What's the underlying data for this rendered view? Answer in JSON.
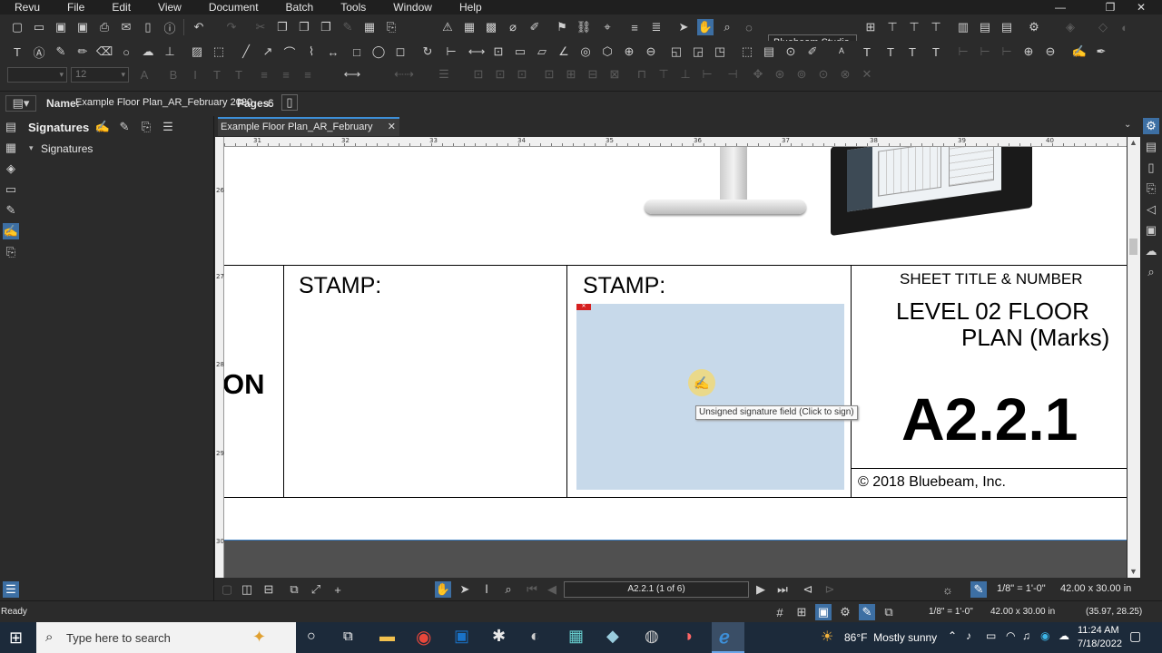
{
  "menu": [
    "Revu",
    "File",
    "Edit",
    "View",
    "Document",
    "Batch",
    "Tools",
    "Window",
    "Help"
  ],
  "toolbar": {
    "profile_label": "Bluebeam Studio",
    "font_name": "",
    "font_size": "12"
  },
  "docinfo": {
    "name_label": "Name:",
    "name_value": "Example Floor Plan_AR_February 2020",
    "pages_label": "Pages:",
    "pages_value": "6"
  },
  "signatures_panel": {
    "title": "Signatures",
    "tree_item": "Signatures"
  },
  "tab": {
    "title": "Example Floor Plan_AR_February 2020*"
  },
  "ruler": {
    "h_ticks": [
      "31",
      "32",
      "33",
      "34",
      "35",
      "36",
      "37",
      "38",
      "39",
      "40"
    ],
    "v_ticks": [
      "26",
      "27",
      "28",
      "29",
      "30"
    ]
  },
  "drawing": {
    "partial_text": "ON",
    "stamp1_label": "STAMP:",
    "stamp2_label": "STAMP:",
    "sheet_title_heading": "SHEET TITLE & NUMBER",
    "sheet_title_line1": "LEVEL 02 FLOOR",
    "sheet_title_line2": "PLAN (Marks)",
    "sheet_number": "A2.2.1",
    "copyright": "© 2018 Bluebeam, Inc.",
    "tooltip": "Unsigned signature field (Click to sign)",
    "signature_field_color": "#c7d9ea"
  },
  "navigation": {
    "page_indicator": "A2.2.1 (1 of 6)",
    "scale": "1/8\" = 1'-0\"",
    "paper_size": "42.00 x 30.00 in"
  },
  "status": {
    "ready": "Ready",
    "scale": "1/8\" = 1'-0\"",
    "paper_size": "42.00 x 30.00 in",
    "cursor_coords": "(35.97, 28.25)"
  },
  "taskbar": {
    "search_placeholder": "Type here to search",
    "weather": "86°F  Mostly sunny",
    "time": "11:24 AM",
    "date": "7/18/2022"
  },
  "colors": {
    "accent": "#3d8fd8",
    "taskbar": "#1c2a3a",
    "dark_bg": "#2b2b2b"
  }
}
